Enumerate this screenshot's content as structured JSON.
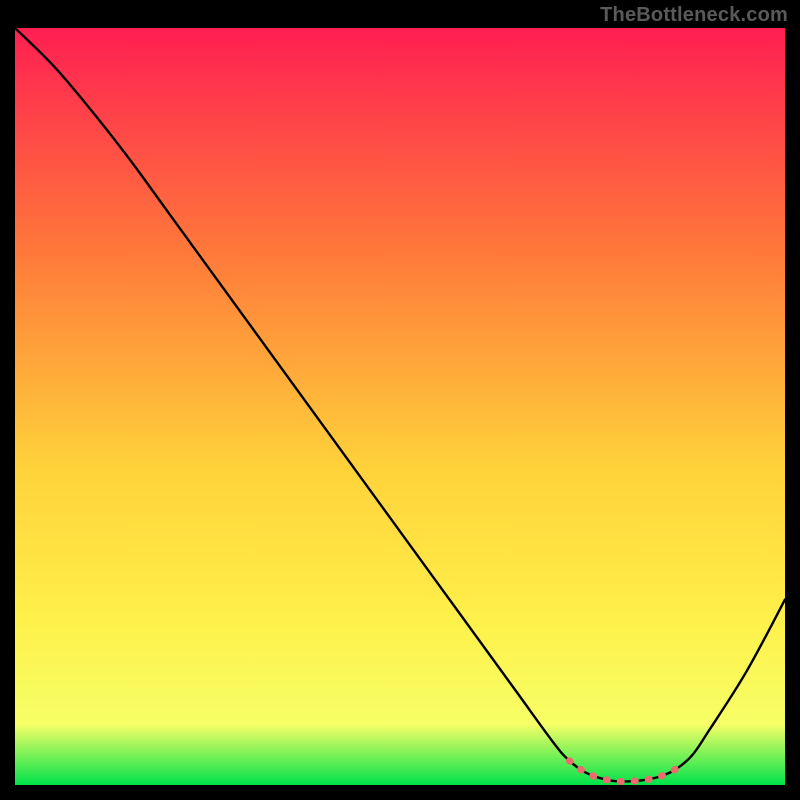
{
  "watermark": "TheBottleneck.com",
  "colors": {
    "background": "#000000",
    "gradient_top": "#ff1f52",
    "gradient_mid1": "#ff7a3a",
    "gradient_mid2": "#ffd23a",
    "gradient_mid3": "#fff04a",
    "gradient_mid4": "#f6ff66",
    "gradient_bottom": "#00e24a",
    "curve": "#000000",
    "highlight": "#ef6a6f"
  },
  "chart_data": {
    "type": "line",
    "title": "",
    "xlabel": "",
    "ylabel": "",
    "x": [
      0,
      5,
      10,
      15,
      20,
      25,
      30,
      35,
      40,
      45,
      50,
      55,
      60,
      65,
      70,
      72,
      74,
      76,
      78,
      80,
      82,
      84,
      86,
      88,
      90,
      95,
      100
    ],
    "values": [
      100,
      95,
      89,
      82.5,
      75.5,
      68.5,
      61.5,
      54.5,
      47.5,
      40.5,
      33.5,
      26.5,
      19.5,
      12.5,
      5.5,
      3.2,
      1.7,
      0.9,
      0.5,
      0.5,
      0.7,
      1.2,
      2.2,
      4.0,
      7.0,
      15.0,
      24.5
    ],
    "xlim": [
      0,
      100
    ],
    "ylim": [
      0,
      100
    ],
    "highlight_range_x": [
      71,
      87
    ],
    "series": [
      {
        "name": "bottleneck-curve",
        "x": [
          0,
          5,
          10,
          15,
          20,
          25,
          30,
          35,
          40,
          45,
          50,
          55,
          60,
          65,
          70,
          72,
          74,
          76,
          78,
          80,
          82,
          84,
          86,
          88,
          90,
          95,
          100
        ],
        "values": [
          100,
          95,
          89,
          82.5,
          75.5,
          68.5,
          61.5,
          54.5,
          47.5,
          40.5,
          33.5,
          26.5,
          19.5,
          12.5,
          5.5,
          3.2,
          1.7,
          0.9,
          0.5,
          0.5,
          0.7,
          1.2,
          2.2,
          4.0,
          7.0,
          15.0,
          24.5
        ]
      }
    ]
  }
}
